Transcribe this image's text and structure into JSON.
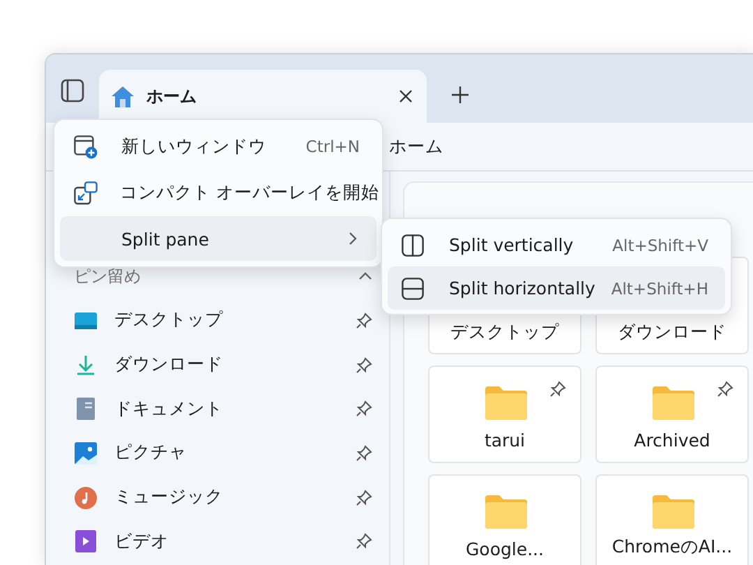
{
  "tabs": [
    {
      "label": "ホーム",
      "selected": true
    }
  ],
  "breadcrumb": "ホーム",
  "sidebar": {
    "section": "ピン留め",
    "expanded": true,
    "items": [
      {
        "label": "デスクトップ",
        "kind": "desktop"
      },
      {
        "label": "ダウンロード",
        "kind": "download"
      },
      {
        "label": "ドキュメント",
        "kind": "document"
      },
      {
        "label": "ピクチャ",
        "kind": "picture"
      },
      {
        "label": "ミュージック",
        "kind": "music"
      },
      {
        "label": "ビデオ",
        "kind": "video"
      }
    ]
  },
  "cards": [
    {
      "label": "デスクトップ",
      "pinned": false,
      "partial": true
    },
    {
      "label": "ダウンロード",
      "pinned": false,
      "partial": true
    },
    {
      "label": "tarui",
      "pinned": true,
      "partial": false
    },
    {
      "label": "Archived",
      "pinned": true,
      "partial": false
    },
    {
      "label": "Google...",
      "pinned": false,
      "partial": false
    },
    {
      "label": "ChromeのAI...",
      "pinned": false,
      "partial": false
    }
  ],
  "menu": [
    {
      "kind": "new-window",
      "label": "新しいウィンドウ",
      "shortcut": "Ctrl+N",
      "selected": false
    },
    {
      "kind": "compact",
      "label": "コンパクト オーバーレイを開始",
      "selected": false
    },
    {
      "kind": "submenu",
      "label": "Split pane",
      "selected": true
    }
  ],
  "submenu": [
    {
      "kind": "vertical",
      "label": "Split vertically",
      "shortcut": "Alt+Shift+V",
      "selected": false
    },
    {
      "kind": "horizontal",
      "label": "Split horizontally",
      "shortcut": "Alt+Shift+H",
      "selected": true
    }
  ]
}
